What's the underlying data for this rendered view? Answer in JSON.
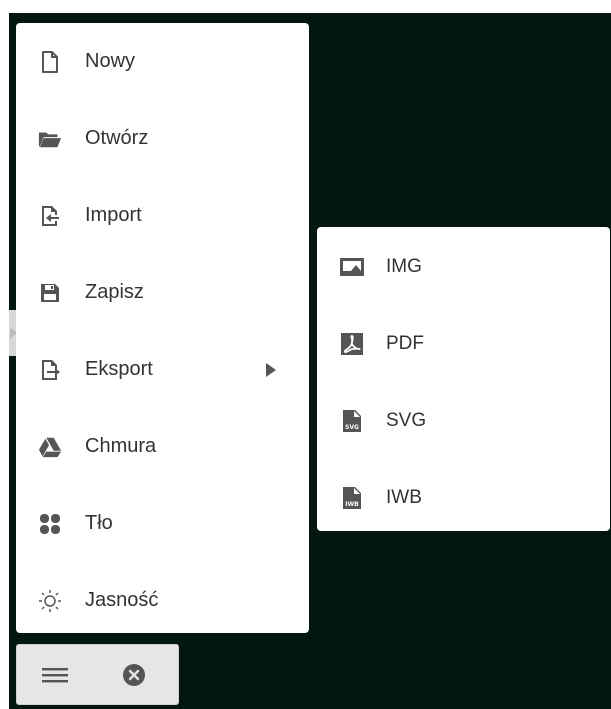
{
  "menu": {
    "items": [
      {
        "label": "Nowy",
        "icon": "new-file-icon"
      },
      {
        "label": "Otwórz",
        "icon": "folder-open-icon"
      },
      {
        "label": "Import",
        "icon": "import-icon"
      },
      {
        "label": "Zapisz",
        "icon": "save-icon"
      },
      {
        "label": "Eksport",
        "icon": "export-icon",
        "has_submenu": true
      },
      {
        "label": "Chmura",
        "icon": "cloud-drive-icon"
      },
      {
        "label": "Tło",
        "icon": "background-icon"
      },
      {
        "label": "Jasność",
        "icon": "brightness-icon"
      }
    ]
  },
  "export_submenu": {
    "items": [
      {
        "label": "IMG",
        "icon": "image-icon"
      },
      {
        "label": "PDF",
        "icon": "pdf-icon"
      },
      {
        "label": "SVG",
        "icon": "svg-file-icon",
        "icon_text": "SVG"
      },
      {
        "label": "IWB",
        "icon": "iwb-file-icon",
        "icon_text": "IWB"
      }
    ]
  },
  "toolbar": {
    "menu_icon": "hamburger-menu-icon",
    "close_icon": "close-circle-icon"
  },
  "colors": {
    "board_background": "#02180f",
    "menu_background": "#ffffff",
    "icon_color": "#555555",
    "text_color": "#333333",
    "toolbar_background": "#e6e6e6"
  }
}
